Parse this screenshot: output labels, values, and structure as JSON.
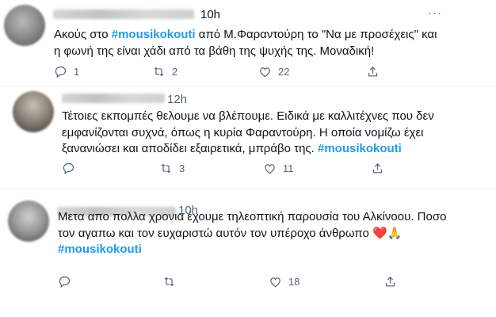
{
  "tweets": [
    {
      "time": "10h",
      "text_parts": [
        "Ακούς στο ",
        "#mousikokouti",
        " από Μ.Φαραντούρη το \"Να με προσέχεις\" και",
        "η φωνή της είναι χάδι από τα βάθη της ψυχής της. Μοναδική!"
      ],
      "replies": "1",
      "retweets": "2",
      "likes": "22",
      "more": "···"
    },
    {
      "time": "12h",
      "lines": [
        "Τέτοιες εκπομπές θελουμε να βλέπουμε. Ειδικά με καλλιτέχνες που δεν",
        "εμφανίζονται συχνά, όπως η κυρία Φαραντούρη. Η οποία νομίζω έχει",
        "ξαναν­ιώσει και αποδίδει εξαιρετικά, μπράβο της. "
      ],
      "hashtag": "#mousikokouti",
      "replies": "",
      "retweets": "3",
      "likes": "11"
    },
    {
      "time": "10h",
      "lines": [
        "Μετα απο πολλα χρονια έχουμε τηλεοπτική παρουσία του Αλκίνοου. Ποσο",
        "τον αγαπω και τον ευχαριστώ αυτόν τον υπέροχο άνθρωπο "
      ],
      "emoji": "❤️🙏",
      "hashtag": "#mousikokouti",
      "replies": "",
      "retweets": "",
      "likes": "18"
    }
  ],
  "icons": [
    "reply-icon",
    "retweet-icon",
    "like-icon",
    "share-icon",
    "more-icon"
  ],
  "colors": {
    "hashtag": "#1d9bf0",
    "secondary_text": "#536471",
    "text": "#0f1419"
  }
}
